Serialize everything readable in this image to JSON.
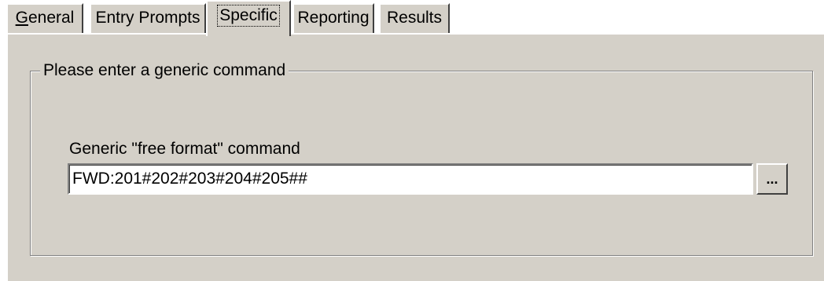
{
  "tabs": [
    {
      "label_mnemonic": "G",
      "label_rest": "eneral",
      "active": false
    },
    {
      "label": "Entry Prompts",
      "active": false
    },
    {
      "label": "Specific",
      "active": true
    },
    {
      "label": "Reporting",
      "active": false
    },
    {
      "label": "Results",
      "active": false
    }
  ],
  "group": {
    "legend": "Please enter a generic command",
    "field_label": "Generic \"free format\" command",
    "command_value": "FWD:201#202#203#204#205##",
    "browse_label": "..."
  },
  "colors": {
    "face": "#d4d0c8",
    "highlight": "#ffffff",
    "shadow": "#808080",
    "dark_shadow": "#404040"
  }
}
